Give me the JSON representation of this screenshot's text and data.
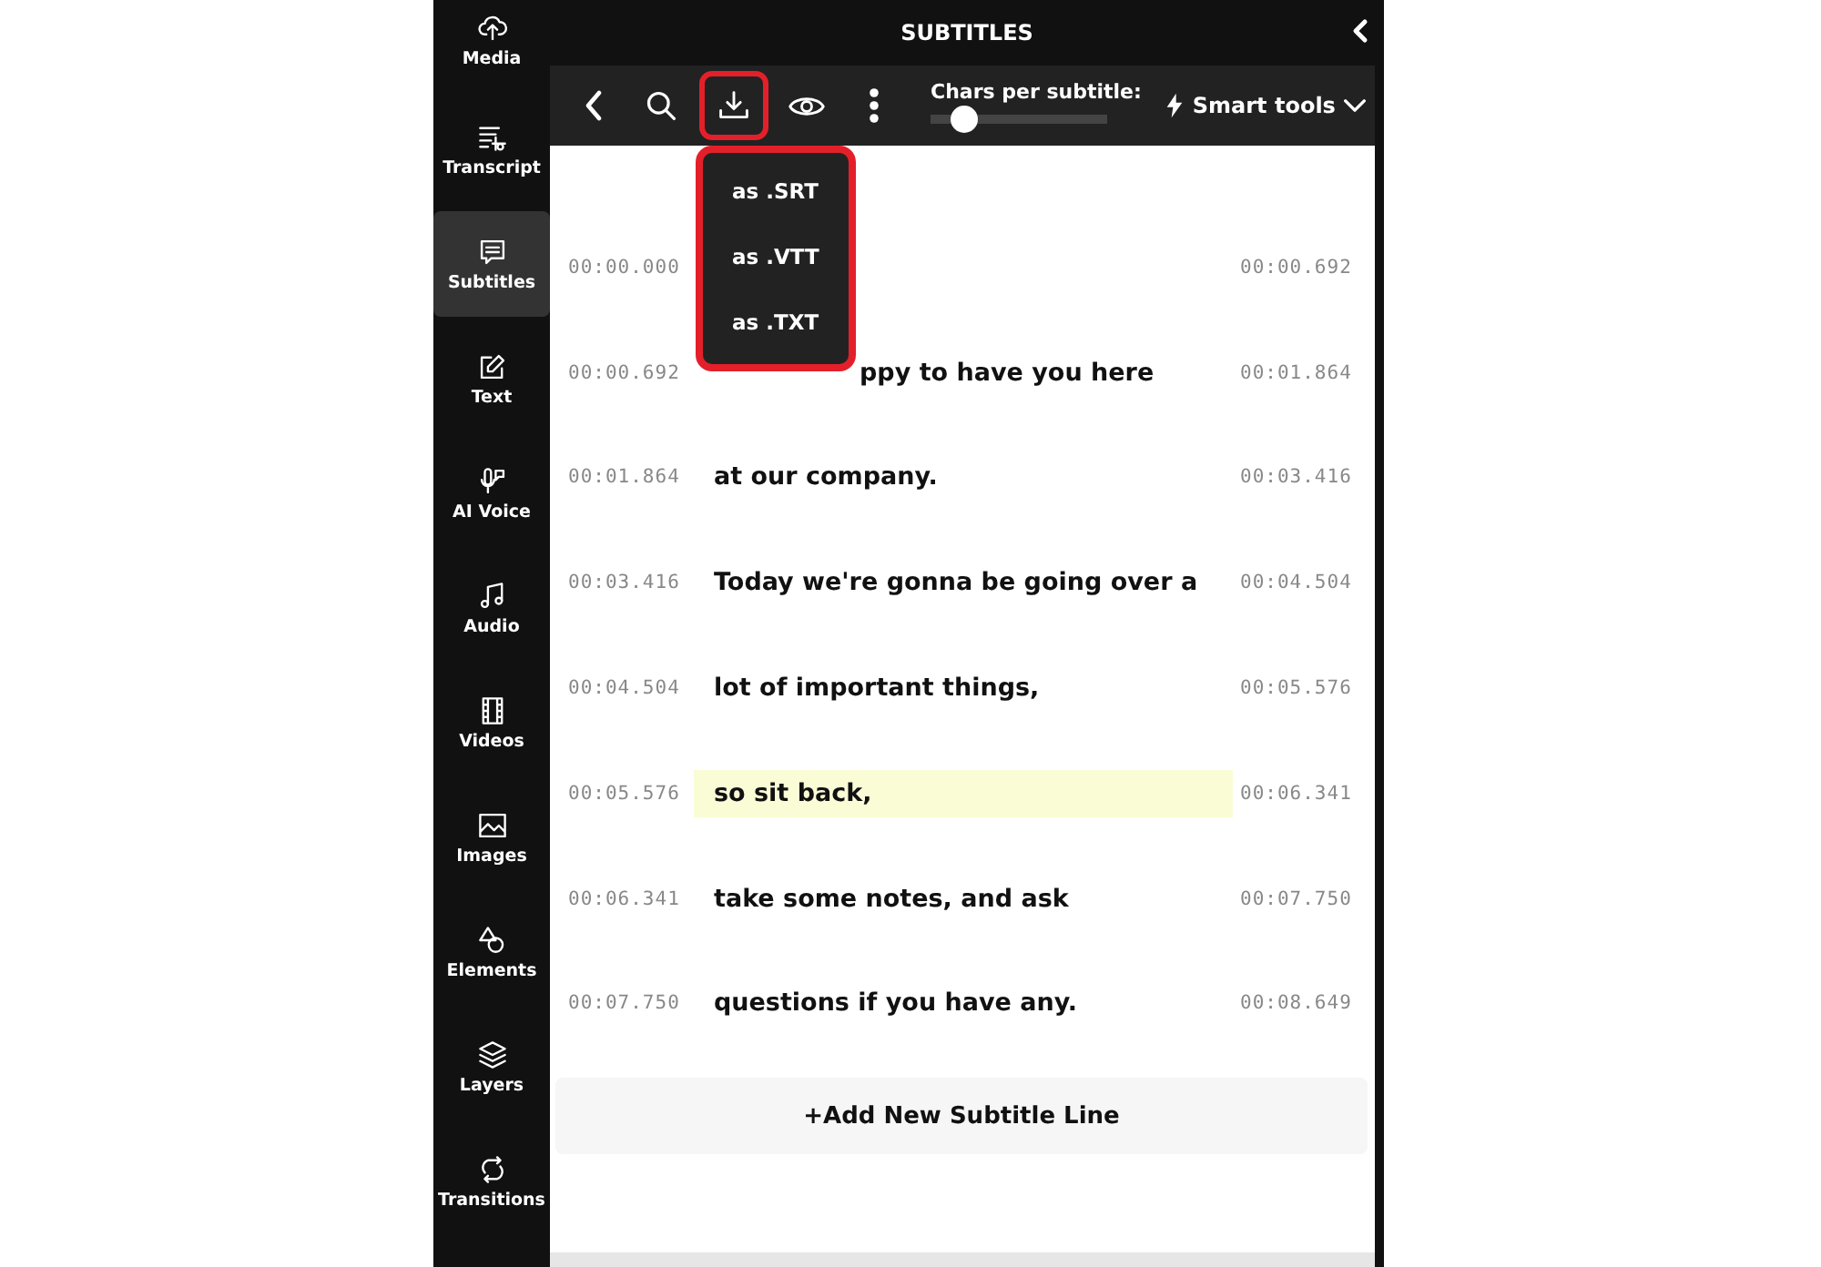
{
  "sidebar": {
    "items": [
      {
        "label": "Media",
        "selected": false
      },
      {
        "label": "Transcript",
        "selected": false
      },
      {
        "label": "Subtitles",
        "selected": true
      },
      {
        "label": "Text",
        "selected": false
      },
      {
        "label": "AI Voice",
        "selected": false
      },
      {
        "label": "Audio",
        "selected": false
      },
      {
        "label": "Videos",
        "selected": false
      },
      {
        "label": "Images",
        "selected": false
      },
      {
        "label": "Elements",
        "selected": false
      },
      {
        "label": "Layers",
        "selected": false
      },
      {
        "label": "Transitions",
        "selected": false
      }
    ]
  },
  "panel": {
    "title": "SUBTITLES"
  },
  "toolbar": {
    "chars_label": "Chars per subtitle:",
    "chars_slider": {
      "level": 0.2
    },
    "smart_tools": "Smart tools"
  },
  "download_menu": {
    "items": [
      "as .SRT",
      "as .VTT",
      "as .TXT"
    ]
  },
  "rows": [
    {
      "start": "00:00.000",
      "end": "00:00.692",
      "highlighted": false
    },
    {
      "start": "00:00.692",
      "text": "ppy to have you here",
      "end": "00:01.864",
      "highlighted": false,
      "partly_covered": true
    },
    {
      "start": "00:01.864",
      "text": "at our company.",
      "end": "00:03.416",
      "highlighted": false
    },
    {
      "start": "00:03.416",
      "text": "Today we're gonna be going over a",
      "end": "00:04.504",
      "highlighted": false
    },
    {
      "start": "00:04.504",
      "text": "lot of important things,",
      "end": "00:05.576",
      "highlighted": false
    },
    {
      "start": "00:05.576",
      "text": "so sit back,",
      "end": "00:06.341",
      "highlighted": true
    },
    {
      "start": "00:06.341",
      "text": "take some notes, and ask",
      "end": "00:07.750",
      "highlighted": false
    },
    {
      "start": "00:07.750",
      "text": "questions if you have any.",
      "end": "00:08.649",
      "highlighted": false
    }
  ],
  "add_line": "+Add New Subtitle Line"
}
